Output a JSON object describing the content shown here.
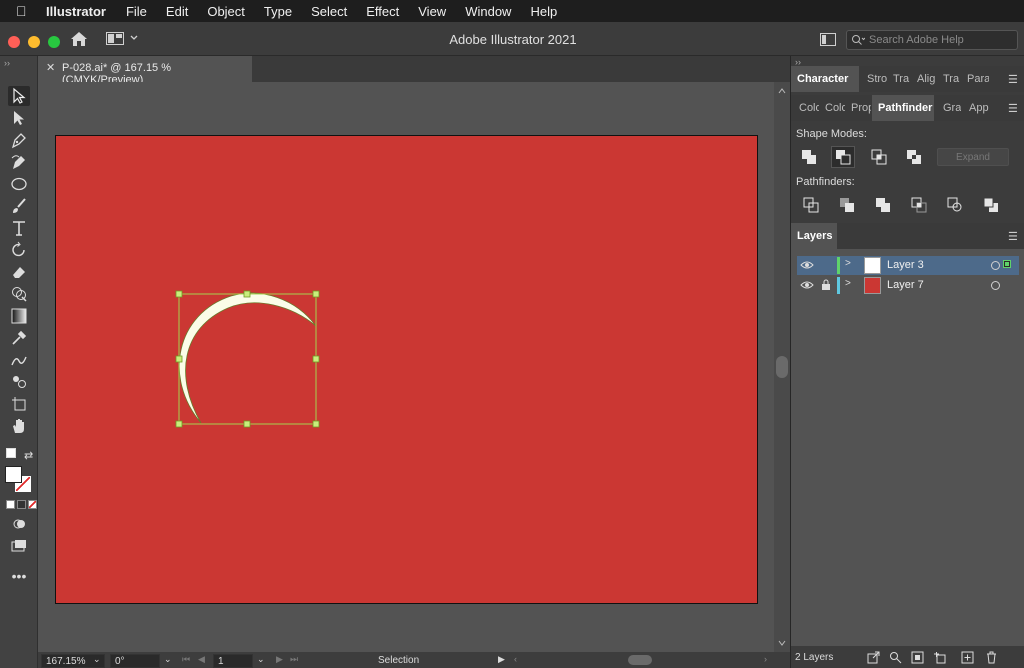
{
  "menubar": {
    "app_name": "Illustrator",
    "items": [
      "File",
      "Edit",
      "Object",
      "Type",
      "Select",
      "Effect",
      "View",
      "Window",
      "Help"
    ]
  },
  "window": {
    "title": "Adobe Illustrator 2021",
    "search_placeholder": "Search Adobe Help"
  },
  "document": {
    "tab_label": "P-028.ai* @ 167.15 % (CMYK/Preview)",
    "artboard_color": "#cb3733",
    "shape_fill": "#fbfde8",
    "selection_color": "#a5d34f"
  },
  "panels": {
    "top_tabs": [
      "Character",
      "Stro",
      "Tra",
      "Alig",
      "Tra",
      "Para"
    ],
    "second_tabs": [
      "Colo",
      "Colo",
      "Prop",
      "Pathfinder",
      "Gra",
      "App"
    ],
    "shape_modes_label": "Shape Modes:",
    "expand_label": "Expand",
    "pathfinders_label": "Pathfinders:",
    "layers_title": "Layers",
    "layers": [
      {
        "name": "Layer 3",
        "color": "#5fd36b",
        "thumb": "#ffffff",
        "selected": true,
        "locked": false
      },
      {
        "name": "Layer 7",
        "color": "#5fc8e0",
        "thumb": "#cb3733",
        "selected": false,
        "locked": true
      }
    ],
    "layers_count": "2 Layers"
  },
  "status": {
    "zoom": "167.15%",
    "rotation": "0°",
    "artboard_num": "1",
    "tool": "Selection"
  },
  "colors": {
    "accent_selected_row": "#4d6a8a"
  }
}
